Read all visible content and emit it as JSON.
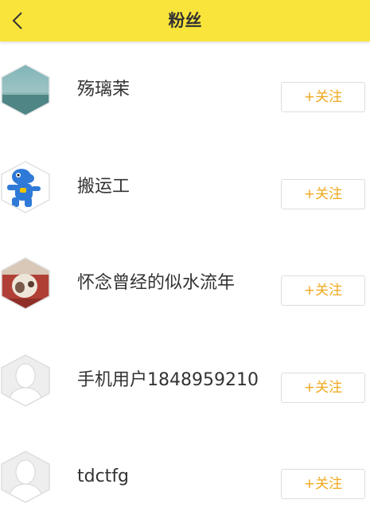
{
  "header": {
    "title": "粉丝",
    "back_icon": "chevron-left-icon",
    "background": "#f8e43a"
  },
  "accent_color": "#f0a81e",
  "fans": [
    {
      "name": "殇璃茉",
      "avatar": "landscape-avatar",
      "follow_label": "+关注"
    },
    {
      "name": "搬运工",
      "avatar": "blue-dog-avatar",
      "follow_label": "+关注"
    },
    {
      "name": "怀念曾经的似水流年",
      "avatar": "photo-avatar",
      "follow_label": "+关注"
    },
    {
      "name": "手机用户1848959210",
      "avatar": "default-avatar",
      "follow_label": "+关注"
    },
    {
      "name": "tdctfg",
      "avatar": "default-avatar",
      "follow_label": "+关注"
    }
  ]
}
